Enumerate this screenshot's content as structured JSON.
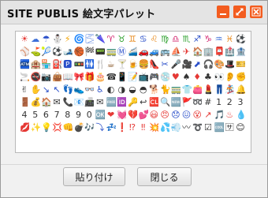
{
  "window": {
    "title": "SITE PUBLIS 絵文字パレット",
    "accent_color": "#f35c1f",
    "controls": [
      {
        "name": "minimize-icon"
      },
      {
        "name": "maximize-icon"
      },
      {
        "name": "close-icon"
      }
    ]
  },
  "palette": {
    "rows": [
      {
        "glyphs": [
          "☀",
          "☁",
          "☂",
          "⛄",
          "⚡",
          "🌀",
          "🌫",
          "🌂",
          "♈",
          "♉",
          "♊",
          "♋",
          "♌",
          "♍",
          "♎",
          "♏",
          "♐",
          "♑",
          "♒",
          "♓",
          "⚽"
        ],
        "colors": [
          "#e53935",
          "#3e6fd8",
          "#2a4fc9",
          "#3e6fd8",
          "#f2a200",
          "#2a4fc9",
          "#3e6fd8",
          "#2a4fc9",
          "#d11d6a",
          "#2ba02b",
          "#e8891b",
          "#2a4fc9",
          "#e8891b",
          "#2ba02b",
          "#d11d6a",
          "#2ba02b",
          "#2a4fc9",
          "#d11d6a",
          "#3e6fd8",
          "#e8891b",
          "#2a4fc9"
        ]
      },
      {
        "glyphs": [
          "⚾",
          "⛳",
          "🎾",
          "⚽",
          "🎿",
          "🏀",
          "🏁",
          "📟",
          "🚃",
          "Ⓜ",
          "🚄",
          "🚗",
          "🚙",
          "🚌",
          "⛵",
          "✈",
          "🏠",
          "🏢",
          "📮",
          "🏥",
          "🏦"
        ],
        "colors": [
          "#2a4fc9",
          "#2ba02b",
          "#2ba02b",
          "#333333",
          "#2a4fc9",
          "#e8891b",
          "#333333",
          "#2a4fc9",
          "#2ba02b",
          "#2a4fc9",
          "#2a4fc9",
          "#e53935",
          "#2a4fc9",
          "#e8891b",
          "#2a4fc9",
          "#e53935",
          "#e53935",
          "#2a4fc9",
          "#e53935",
          "#e53935",
          "#2a4fc9"
        ]
      },
      {
        "glyphs": [
          "🏧",
          "🏨",
          "🏪",
          "⛽",
          "🅿",
          "🚥",
          "🚻",
          "🍴",
          "☕",
          "🍸",
          "🍺",
          "🍔",
          "👠",
          "✂",
          "🎤",
          "🎥",
          "⬈",
          "🎧",
          "🎨",
          "🎩",
          "🎫"
        ],
        "colors": [
          "#2a4fc9",
          "#d11d6a",
          "#2ba02b",
          "#e53935",
          "#2a4fc9",
          "#e8891b",
          "#2a4fc9",
          "#333333",
          "#8a5a2b",
          "#d11d6a",
          "#e8891b",
          "#8a5a2b",
          "#d11d6a",
          "#2a4fc9",
          "#d11d6a",
          "#333333",
          "#2a4fc9",
          "#333333",
          "#d11d6a",
          "#333333",
          "#2a4fc9"
        ]
      },
      {
        "glyphs": [
          "🚬",
          "🚭",
          "📷",
          "👜",
          "📖",
          "🎀",
          "🎁",
          "🎂",
          "☎",
          "📱",
          "📝",
          "📺",
          "🎮",
          "💿",
          "♥",
          "♠",
          "♦",
          "♣",
          "👀",
          "👂",
          "✊"
        ],
        "colors": [
          "#333333",
          "#e53935",
          "#333333",
          "#e8891b",
          "#2a4fc9",
          "#d11d6a",
          "#e53935",
          "#e8891b",
          "#333333",
          "#333333",
          "#2a4fc9",
          "#333333",
          "#333333",
          "#2a4fc9",
          "#e53935",
          "#333333",
          "#e53935",
          "#333333",
          "#333333",
          "#e8891b",
          "#e8891b"
        ]
      },
      {
        "glyphs": [
          "✌",
          "✋",
          "↘",
          "↖",
          "👣",
          "👟",
          "👓",
          "♿",
          "◐",
          "◑",
          "◒",
          "◓",
          "🐕",
          "🐈",
          "🚃",
          "👕",
          "👛",
          "💄",
          "👖",
          "🏂",
          "🔔"
        ],
        "colors": [
          "#333333",
          "#333333",
          "#2a4fc9",
          "#2a4fc9",
          "#333333",
          "#2a4fc9",
          "#333333",
          "#2a4fc9",
          "#333333",
          "#333333",
          "#333333",
          "#333333",
          "#8a5a2b",
          "#e8891b",
          "#2a4fc9",
          "#2a4fc9",
          "#e8891b",
          "#d11d6a",
          "#2a4fc9",
          "#333333",
          "#e8891b"
        ]
      },
      {
        "glyphs": [
          "🚪",
          "💰",
          "🏠",
          "✉",
          "📞",
          "📧",
          "📠",
          "✉",
          "🆓",
          "🆔",
          "🔑",
          "↩",
          "🆑",
          "🔍",
          "🆕",
          "🚩",
          "➿",
          "#",
          "1",
          "2",
          "3"
        ],
        "colors": [
          "#8a5a2b",
          "#2ba02b",
          "#333333",
          "#333333",
          "#333333",
          "#2a4fc9",
          "#333333",
          "#333333",
          "#e53935",
          "#e53935",
          "#e8891b",
          "#333333",
          "#d11d6a",
          "#333333",
          "#333333",
          "#e53935",
          "#333333",
          "#333333",
          "#333333",
          "#333333",
          "#333333"
        ]
      },
      {
        "glyphs": [
          "4",
          "5",
          "6",
          "7",
          "8",
          "9",
          "0",
          "🆗",
          "❤",
          "💓",
          "💔",
          "💕",
          "😃",
          "😠",
          "😞",
          "😖",
          "😵",
          "↗",
          "🎵",
          "♨",
          "💧"
        ],
        "colors": [
          "#333333",
          "#333333",
          "#333333",
          "#333333",
          "#333333",
          "#333333",
          "#333333",
          "#e53935",
          "#e53935",
          "#e53935",
          "#e53935",
          "#d11d6a",
          "#e53935",
          "#e53935",
          "#2a4fc9",
          "#2a4fc9",
          "#e53935",
          "#e53935",
          "#e53935",
          "#e53935",
          "#2a4fc9"
        ]
      },
      {
        "glyphs": [
          "💋",
          "✨",
          "💡",
          "💢",
          "👊",
          "💣",
          "🎶",
          "⤵",
          "💤",
          "❗",
          "⁉",
          "‼",
          "💥",
          "💦",
          "💨",
          "〰",
          "➰",
          "☑",
          "🆒",
          "🈂",
          "😊"
        ],
        "colors": [
          "#e53935",
          "#f2a200",
          "#f2a200",
          "#e53935",
          "#333333",
          "#333333",
          "#e53935",
          "#2a4fc9",
          "#2a4fc9",
          "#e53935",
          "#e53935",
          "#e53935",
          "#e53935",
          "#2a4fc9",
          "#2a4fc9",
          "#333333",
          "#333333",
          "#333333",
          "#333333",
          "#333333",
          "#333333"
        ]
      }
    ]
  },
  "buttons": {
    "paste": "貼り付け",
    "close": "閉じる"
  }
}
